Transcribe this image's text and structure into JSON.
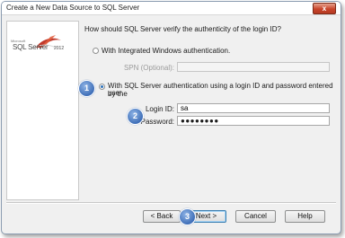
{
  "window": {
    "title": "Create a New Data Source to SQL Server",
    "close_glyph": "x"
  },
  "branding": {
    "logo_small": "Microsoft",
    "product": "SQL Server",
    "year": "2012"
  },
  "content": {
    "question": "How should SQL Server verify the authenticity of the login ID?",
    "option_windows": "With Integrated Windows authentication.",
    "spn_label": "SPN (Optional):",
    "spn_value": "",
    "option_sql_line1": "With SQL Server authentication using a login ID and password entered by the",
    "option_sql_line2": "user.",
    "selected_option": "sql",
    "login_label": "Login ID:",
    "login_value": "sa",
    "password_label": "Password:",
    "password_value": "●●●●●●●●"
  },
  "callouts": [
    "1",
    "2",
    "3"
  ],
  "buttons": {
    "back": "< Back",
    "next": "Next >",
    "cancel": "Cancel",
    "help": "Help"
  },
  "colors": {
    "callout": "#3f6fb8",
    "close_button": "#c8442a"
  }
}
